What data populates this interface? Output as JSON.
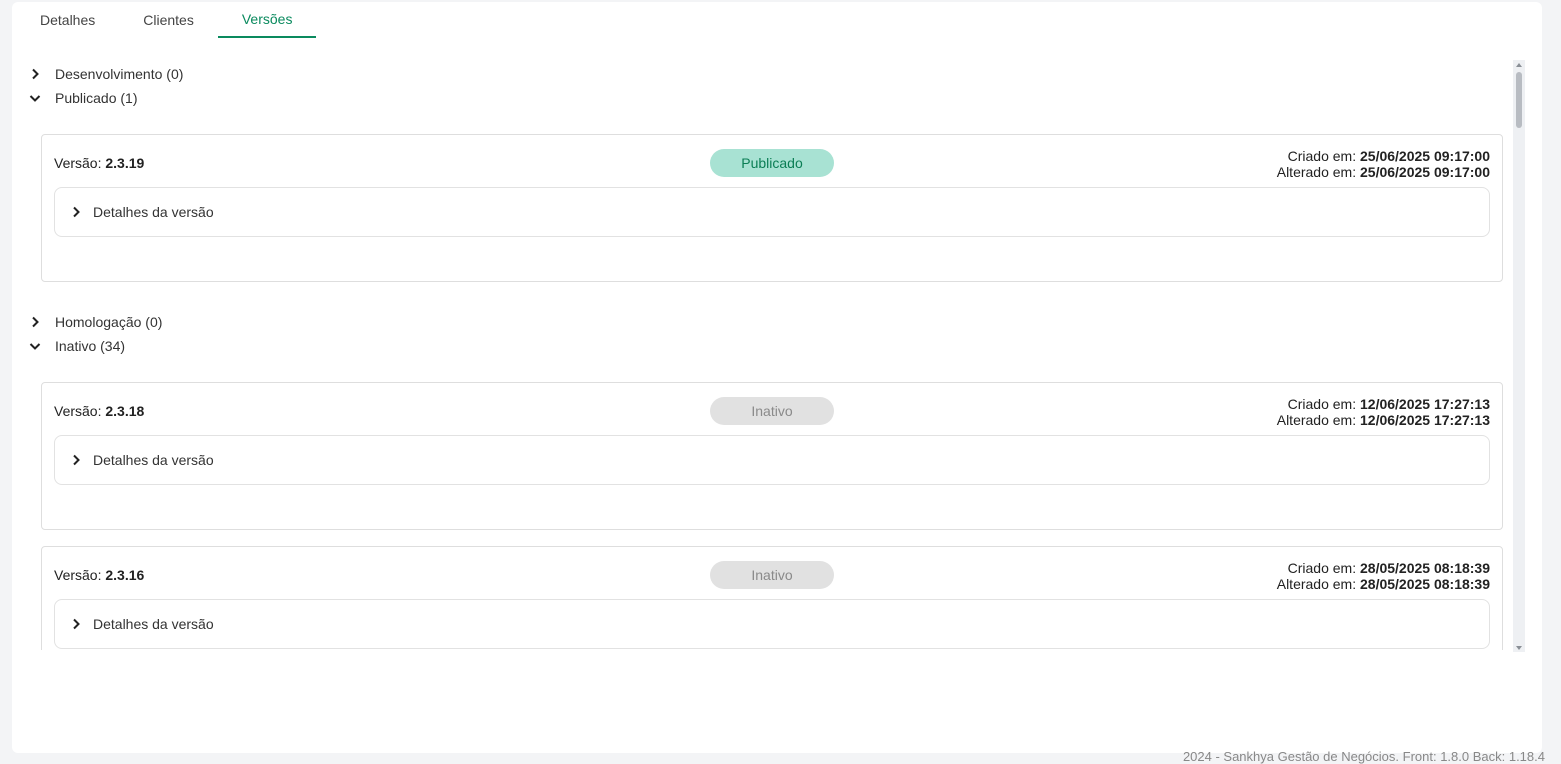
{
  "tabs": [
    {
      "label": "Detalhes",
      "active": false
    },
    {
      "label": "Clientes",
      "active": false
    },
    {
      "label": "Versões",
      "active": true
    }
  ],
  "groups": [
    {
      "label": "Desenvolvimento (0)",
      "expanded": false
    },
    {
      "label": "Publicado (1)",
      "expanded": true
    },
    {
      "label": "Homologação (0)",
      "expanded": false
    },
    {
      "label": "Inativo (34)",
      "expanded": true
    }
  ],
  "labels": {
    "version": "Versão:",
    "created": "Criado em:",
    "modified": "Alterado em:",
    "details": "Detalhes da versão"
  },
  "cards": [
    {
      "version": "2.3.19",
      "status": "Publicado",
      "created": "25/06/2025 09:17:00",
      "modified": "25/06/2025 09:17:00"
    },
    {
      "version": "2.3.18",
      "status": "Inativo",
      "created": "12/06/2025 17:27:13",
      "modified": "12/06/2025 17:27:13"
    },
    {
      "version": "2.3.16",
      "status": "Inativo",
      "created": "28/05/2025 08:18:39",
      "modified": "28/05/2025 08:18:39"
    }
  ],
  "footer": "2024 - Sankhya Gestão de Negócios. Front: 1.8.0 Back: 1.18.4",
  "colors": {
    "accent": "#0a8a5e",
    "published_bg": "#a8e2d3",
    "inactive_bg": "#e1e1e1"
  }
}
